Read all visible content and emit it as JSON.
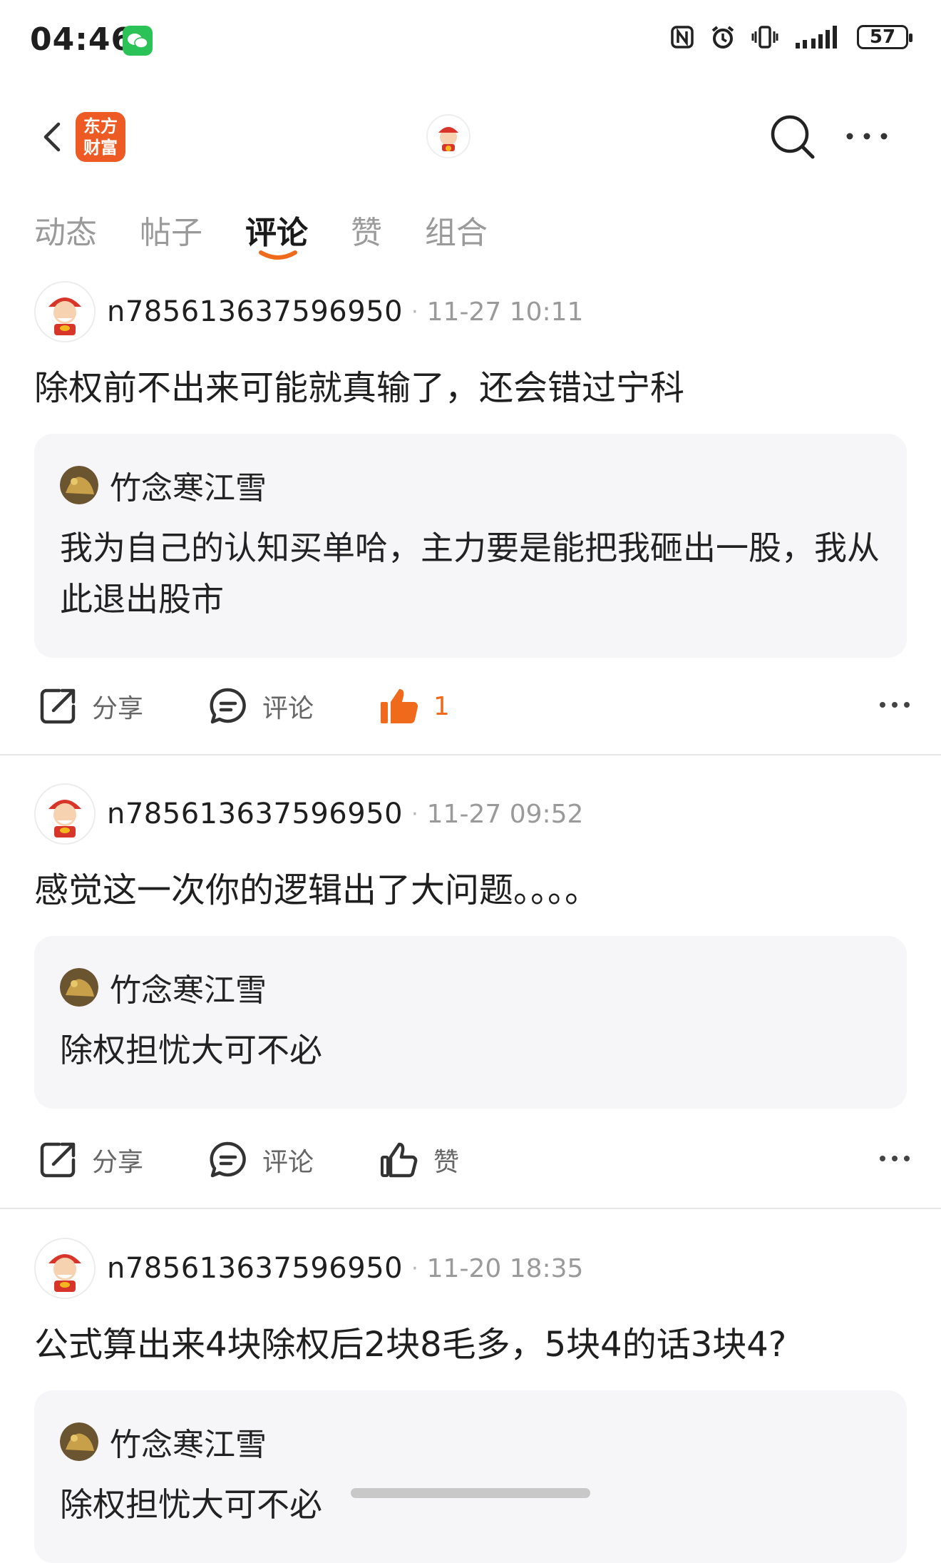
{
  "status": {
    "time": "04:46",
    "battery": "57"
  },
  "nav": {
    "logo_line1": "东方",
    "logo_line2": "财富"
  },
  "tabs": [
    {
      "label": "动态"
    },
    {
      "label": "帖子"
    },
    {
      "label": "评论"
    },
    {
      "label": "赞"
    },
    {
      "label": "组合"
    }
  ],
  "comments": [
    {
      "username": "n785613637596950",
      "time": "11-27 10:11",
      "text": "除权前不出来可能就真输了，还会错过宁科",
      "quote_name": "竹念寒江雪",
      "quote_text": "我为自己的认知买单哈，主力要是能把我砸出一股，我从此退出股市",
      "share_label": "分享",
      "comment_label": "评论",
      "like_label": "1"
    },
    {
      "username": "n785613637596950",
      "time": "11-27 09:52",
      "text": "感觉这一次你的逻辑出了大问题。。。。",
      "quote_name": "竹念寒江雪",
      "quote_text": "除权担忧大可不必",
      "share_label": "分享",
      "comment_label": "评论",
      "like_label": "赞"
    },
    {
      "username": "n785613637596950",
      "time": "11-20 18:35",
      "text": "公式算出来4块除权后2块8毛多，5块4的话3块4?",
      "quote_name": "竹念寒江雪",
      "quote_text": "除权担忧大可不必"
    }
  ],
  "colors": {
    "accent": "#ef6a1a",
    "logo": "#ee5a24",
    "quote_bg": "#f6f6f8"
  }
}
